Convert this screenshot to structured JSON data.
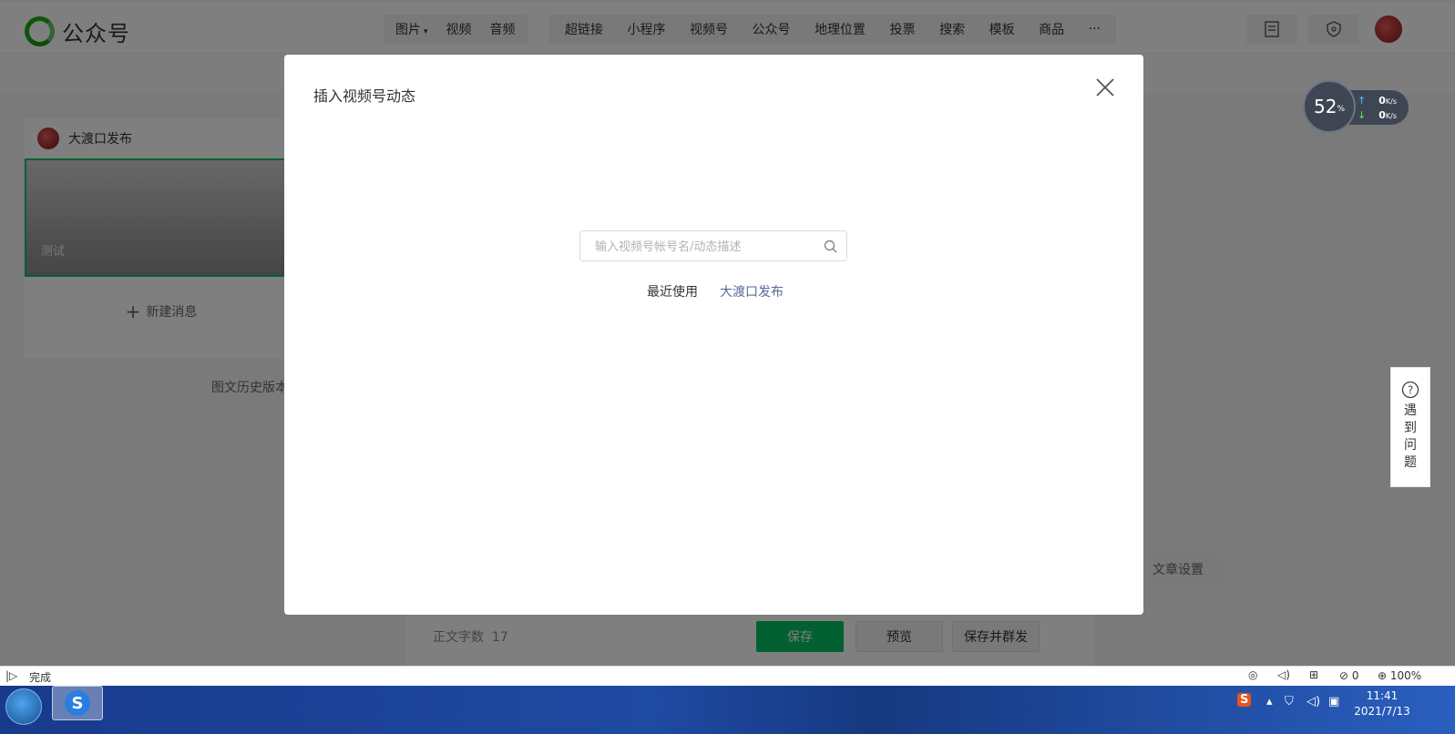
{
  "app": {
    "brand_name": "公众号",
    "toolbar_media": [
      "图片",
      "视频",
      "音频"
    ],
    "toolbar_insert": [
      "超链接",
      "小程序",
      "视频号",
      "公众号",
      "地理位置",
      "投票",
      "搜索",
      "模板",
      "商品",
      "···"
    ]
  },
  "left_panel": {
    "account_name": "大渡口发布",
    "article_title": "测试",
    "new_message": "新建消息",
    "history": "图文历史版本"
  },
  "editor": {
    "word_count_label": "正文字数",
    "word_count": "17",
    "save": "保存",
    "preview": "预览",
    "save_publish": "保存并群发",
    "article_settings": "文章设置"
  },
  "dialog": {
    "title": "插入视频号动态",
    "search_placeholder": "输入视频号帐号名/动态描述",
    "recent_label": "最近使用",
    "recent_account": "大渡口发布"
  },
  "net_widget": {
    "percent": "52",
    "percent_sign": "%",
    "up": "0",
    "down": "0",
    "unit": "K/s"
  },
  "help": {
    "text": [
      "遇",
      "到",
      "问",
      "题"
    ]
  },
  "status_bar": {
    "status": "完成",
    "count": "0",
    "zoom": "100%"
  },
  "taskbar": {
    "time": "11:41",
    "date": "2021/7/13"
  },
  "colors": {
    "brand_green": "#07c160",
    "link_blue": "#576b95"
  }
}
